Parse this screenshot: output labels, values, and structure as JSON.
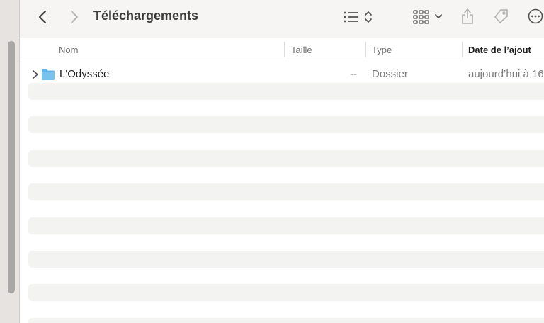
{
  "window": {
    "title": "Téléchargements"
  },
  "toolbar": {
    "back_icon": "chevron-left-icon",
    "forward_icon": "chevron-right-icon",
    "view_icon": "list-view-icon",
    "view_sort_icon": "up-down-chevron-icon",
    "group_icon": "icon-grid-icon",
    "group_menu_icon": "chevron-down-icon",
    "share_icon": "share-icon",
    "tag_icon": "tag-icon",
    "more_icon": "more-ellipsis-icon"
  },
  "columns": {
    "name": "Nom",
    "size": "Taille",
    "type": "Type",
    "date_added": "Date de l’ajout"
  },
  "files": [
    {
      "name": "L'Odyssée",
      "size": "--",
      "type": "Dossier",
      "date_added": "aujourd’hui à 16",
      "icon": "folder-icon",
      "expand_icon": "disclosure-chevron-icon"
    }
  ],
  "colors": {
    "folder_blue": "#5fb3e8",
    "row_stripe": "#f3f3f2",
    "toolbar_bg": "#f6f5f4"
  }
}
